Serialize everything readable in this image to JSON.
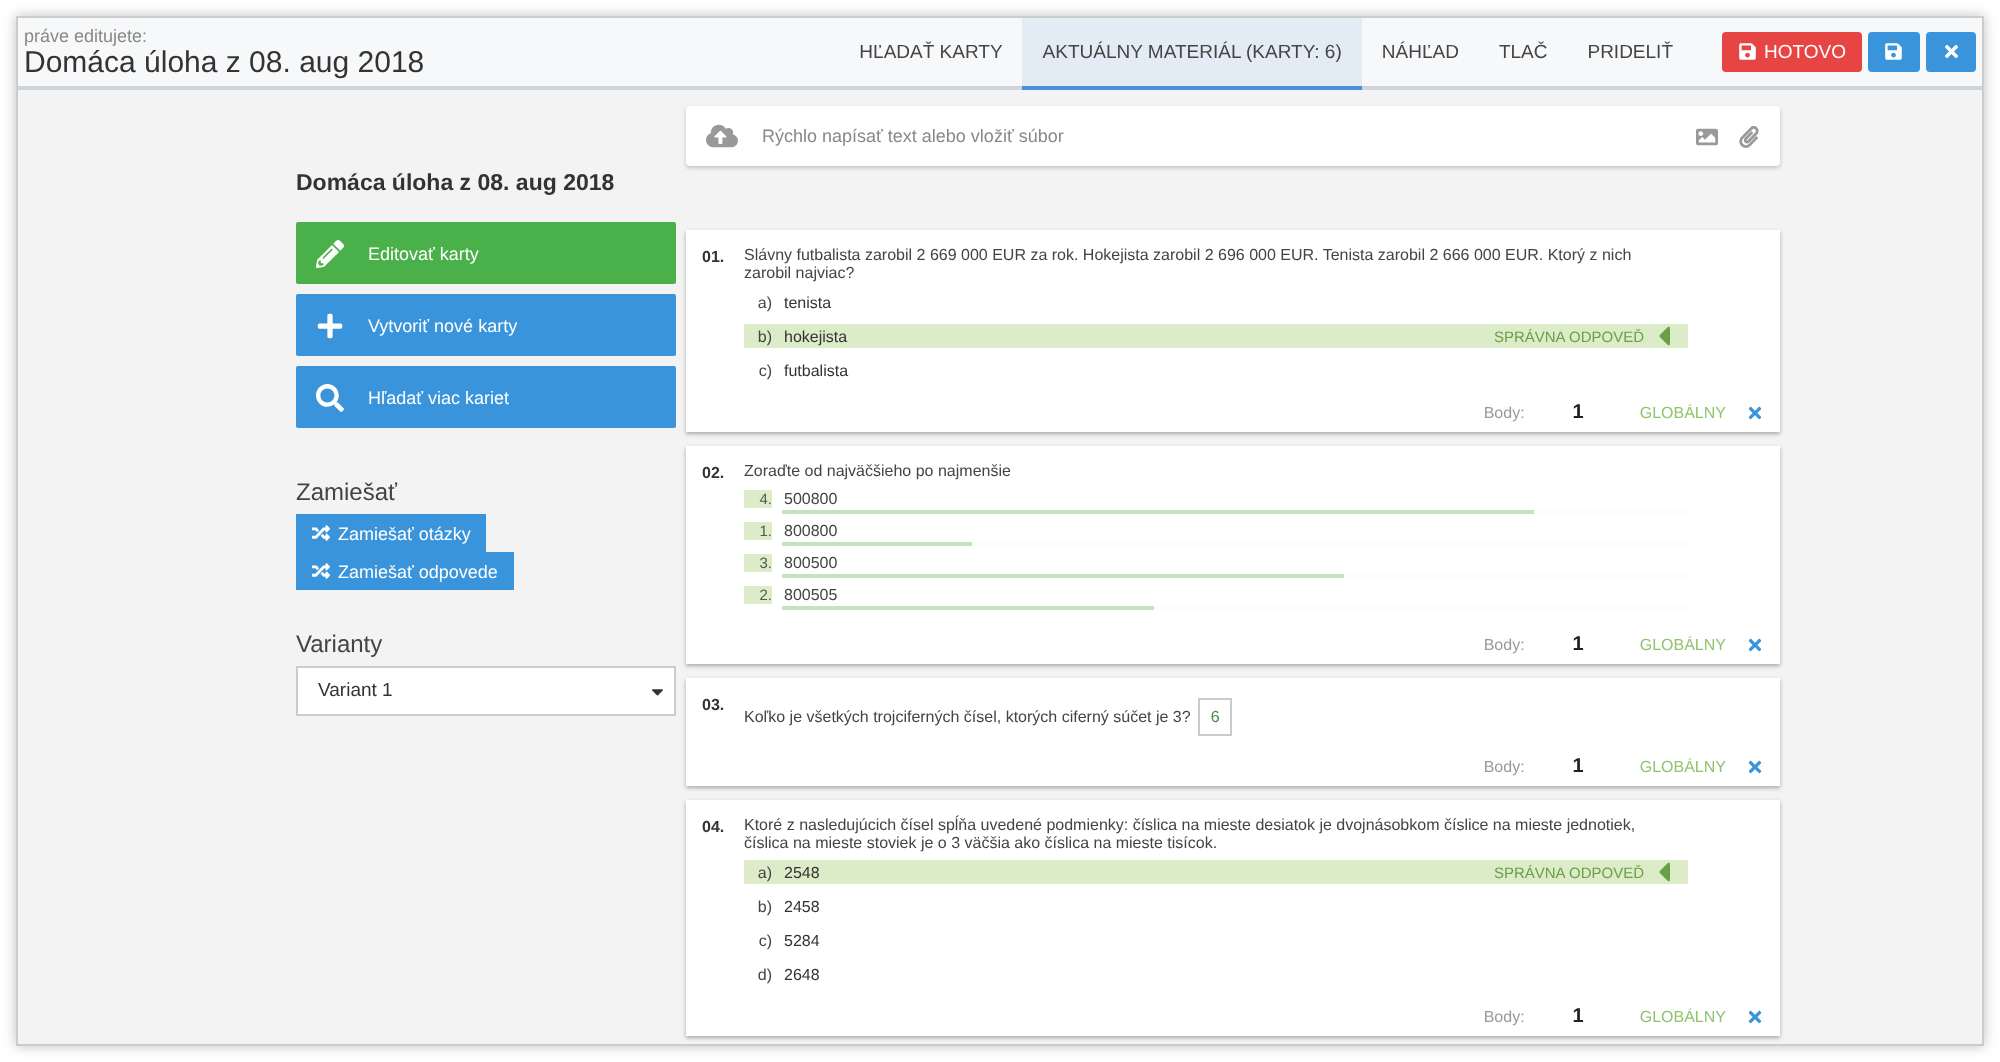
{
  "header": {
    "caption": "práve editujete:",
    "title": "Domáca úloha z 08. aug 2018"
  },
  "tabs": [
    {
      "label": "HĽADAŤ KARTY",
      "selected": false
    },
    {
      "label": "AKTUÁLNY MATERIÁL (KARTY: 6)",
      "selected": true
    },
    {
      "label": "NÁHĽAD",
      "selected": false
    },
    {
      "label": "TLAČ",
      "selected": false
    },
    {
      "label": "PRIDELIŤ",
      "selected": false
    }
  ],
  "done_button": "HOTOVO",
  "quick_input": {
    "placeholder": "Rýchlo napísať text alebo vložiť súbor"
  },
  "sidebar": {
    "title": "Domáca úloha z 08. aug 2018",
    "actions": [
      {
        "label": "Editovať karty",
        "kind": "edit"
      },
      {
        "label": "Vytvoriť nové karty",
        "kind": "create"
      },
      {
        "label": "Hľadať viac kariet",
        "kind": "search"
      }
    ],
    "shuffle_title": "Zamiešať",
    "shuffle_buttons": [
      "Zamiešať otázky",
      "Zamiešať odpovede"
    ],
    "variants_title": "Varianty",
    "variant": "Variant 1"
  },
  "cards": [
    {
      "kind": "choice",
      "number": "01.",
      "question": "Slávny futbalista zarobil 2 669 000 EUR za rok. Hokejista zarobil 2 696 000 EUR. Tenista zarobil  2 666 000 EUR. Ktorý z nich zarobil najviac?",
      "options": [
        {
          "letter": "a)",
          "text": "tenista",
          "correct": false
        },
        {
          "letter": "b)",
          "text": "hokejista",
          "correct": true,
          "tag": "SPRÁVNA ODPOVEĎ"
        },
        {
          "letter": "c)",
          "text": "futbalista",
          "correct": false
        }
      ],
      "points_label": "Body:",
      "points": "1",
      "scope": "GLOBÁLNY"
    },
    {
      "kind": "order",
      "number": "02.",
      "question": "Zoraďte od najväčšieho po najmenšie",
      "items": [
        {
          "rank": "4.",
          "text": "500800",
          "level": 0.83
        },
        {
          "rank": "1.",
          "text": "800800",
          "level": 0.21
        },
        {
          "rank": "3.",
          "text": "800500",
          "level": 0.62
        },
        {
          "rank": "2.",
          "text": "800505",
          "level": 0.41
        }
      ],
      "points_label": "Body:",
      "points": "1",
      "scope": "GLOBÁLNY"
    },
    {
      "kind": "input",
      "number": "03.",
      "question": "Koľko je všetkých trojciferných čísel, ktorých ciferný súčet je 3?",
      "answer": "6",
      "points_label": "Body:",
      "points": "1",
      "scope": "GLOBÁLNY"
    },
    {
      "kind": "choice",
      "number": "04.",
      "question": "Ktoré z nasledujúcich čísel spĺňa uvedené podmienky: číslica na mieste desiatok je dvojnásobkom číslice na mieste jednotiek, číslica na mieste stoviek je o 3 väčšia ako číslica na mieste tisícok.",
      "options": [
        {
          "letter": "a)",
          "text": "2548",
          "correct": true,
          "tag": "SPRÁVNA ODPOVEĎ"
        },
        {
          "letter": "b)",
          "text": "2458",
          "correct": false
        },
        {
          "letter": "c)",
          "text": "5284",
          "correct": false
        },
        {
          "letter": "d)",
          "text": "2648",
          "correct": false
        }
      ],
      "points_label": "Body:",
      "points": "1",
      "scope": "GLOBÁLNY"
    }
  ]
}
